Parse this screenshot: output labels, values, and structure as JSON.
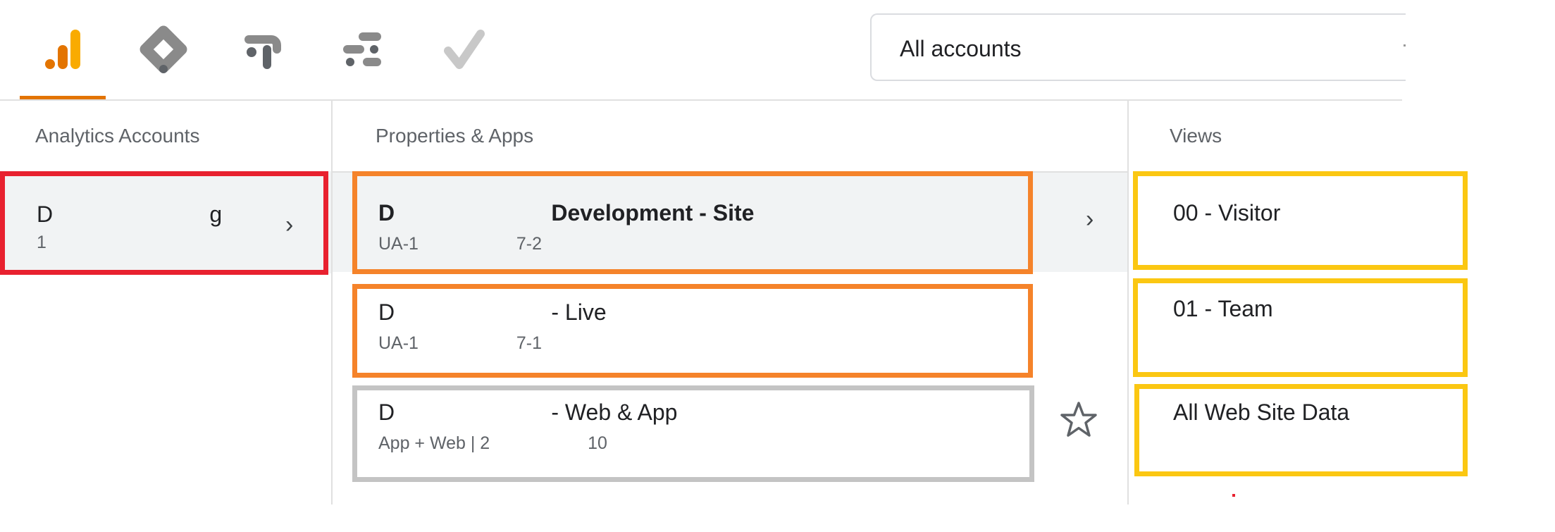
{
  "products": [
    {
      "name": "analytics-icon",
      "active": true
    },
    {
      "name": "tag-manager-icon",
      "active": false
    },
    {
      "name": "optimize-icon",
      "active": false
    },
    {
      "name": "data-studio-icon",
      "active": false
    },
    {
      "name": "surveys-icon",
      "active": false
    }
  ],
  "account_selector": {
    "label": "All accounts"
  },
  "columns": {
    "accounts": {
      "header": "Analytics Accounts",
      "items": [
        {
          "title": "D                         g",
          "sub": "1"
        }
      ]
    },
    "properties": {
      "header": "Properties & Apps",
      "items": [
        {
          "title": "D                         Development - Site",
          "sub": "UA-1                    7-2"
        },
        {
          "title": "D                         - Live",
          "sub": "UA-1                    7-1"
        },
        {
          "title": "D                         - Web & App",
          "sub": "App + Web | 2                    10"
        }
      ]
    },
    "views": {
      "header": "Views",
      "items": [
        {
          "title": "00 - Visitor"
        },
        {
          "title": "01 - Team"
        },
        {
          "title": "All Web Site Data"
        }
      ]
    }
  },
  "colors": {
    "highlight_red": "#e8212f",
    "highlight_orange": "#f5832a",
    "highlight_gray": "#c4c4c4",
    "highlight_yellow": "#fbc712",
    "analytics_active": "#e37400"
  }
}
